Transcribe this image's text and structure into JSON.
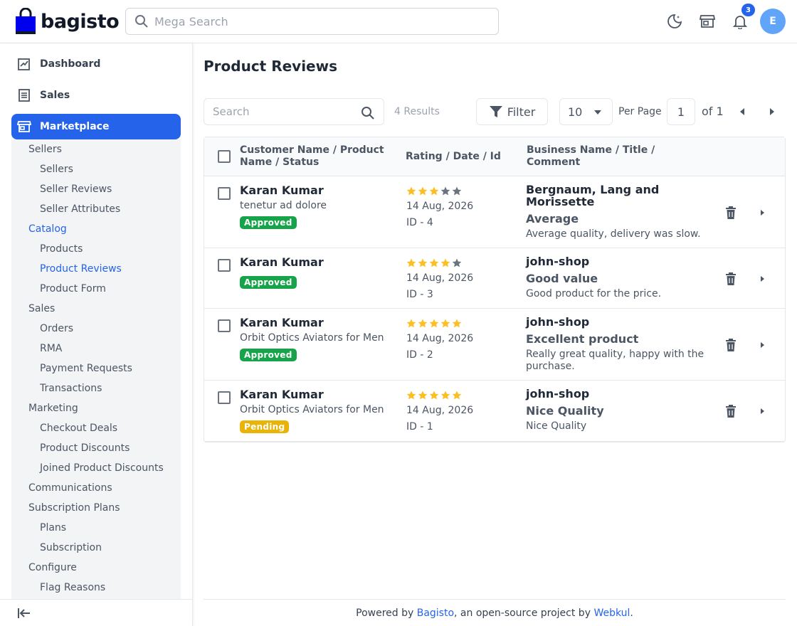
{
  "header": {
    "logo_text": "bagisto",
    "search_placeholder": "Mega Search",
    "notification_count": "3",
    "avatar_initial": "E"
  },
  "sidebar": {
    "top_items": [
      {
        "label": "Dashboard",
        "icon": "dashboard-icon"
      },
      {
        "label": "Sales",
        "icon": "sales-icon"
      },
      {
        "label": "Marketplace",
        "icon": "store-icon",
        "active": true
      }
    ],
    "submenu": [
      {
        "label": "Sellers",
        "level": 1
      },
      {
        "label": "Sellers",
        "level": 2
      },
      {
        "label": "Seller Reviews",
        "level": 2
      },
      {
        "label": "Seller Attributes",
        "level": 2
      },
      {
        "label": "Catalog",
        "level": 1,
        "highlighted": true
      },
      {
        "label": "Products",
        "level": 2
      },
      {
        "label": "Product Reviews",
        "level": 2,
        "highlighted": true
      },
      {
        "label": "Product Form",
        "level": 2
      },
      {
        "label": "Sales",
        "level": 1
      },
      {
        "label": "Orders",
        "level": 2
      },
      {
        "label": "RMA",
        "level": 2
      },
      {
        "label": "Payment Requests",
        "level": 2
      },
      {
        "label": "Transactions",
        "level": 2
      },
      {
        "label": "Marketing",
        "level": 1
      },
      {
        "label": "Checkout Deals",
        "level": 2
      },
      {
        "label": "Product Discounts",
        "level": 2
      },
      {
        "label": "Joined Product Discounts",
        "level": 2
      },
      {
        "label": "Communications",
        "level": 1
      },
      {
        "label": "Subscription Plans",
        "level": 1
      },
      {
        "label": "Plans",
        "level": 2
      },
      {
        "label": "Subscription",
        "level": 2
      },
      {
        "label": "Configure",
        "level": 1
      },
      {
        "label": "Flag Reasons",
        "level": 2
      }
    ]
  },
  "main": {
    "title": "Product Reviews",
    "search_placeholder": "Search",
    "results_label": "4 Results",
    "filter_label": "Filter",
    "per_page_value": "10",
    "per_page_label": "Per Page",
    "current_page": "1",
    "of_pages": "of 1"
  },
  "table": {
    "headers": {
      "customer": "Customer Name / Product Name / Status",
      "rating": "Rating / Date / Id",
      "business": "Business Name / Title / Comment"
    },
    "rows": [
      {
        "customer": "Karan Kumar",
        "product": "tenetur ad dolore",
        "status": "Approved",
        "rating": 3,
        "date": "14 Aug, 2026",
        "id": "ID - 4",
        "business": "Bergnaum, Lang and Morissette",
        "title": "Average",
        "comment": "Average quality, delivery was slow."
      },
      {
        "customer": "Karan Kumar",
        "product": "",
        "status": "Approved",
        "rating": 4,
        "date": "14 Aug, 2026",
        "id": "ID - 3",
        "business": "john-shop",
        "title": "Good value",
        "comment": "Good product for the price."
      },
      {
        "customer": "Karan Kumar",
        "product": "Orbit Optics Aviators for Men",
        "status": "Approved",
        "rating": 5,
        "date": "14 Aug, 2026",
        "id": "ID - 2",
        "business": "john-shop",
        "title": "Excellent product",
        "comment": "Really great quality, happy with the purchase."
      },
      {
        "customer": "Karan Kumar",
        "product": "Orbit Optics Aviators for Men",
        "status": "Pending",
        "rating": 5,
        "date": "14 Aug, 2026",
        "id": "ID - 1",
        "business": "john-shop",
        "title": "Nice Quality",
        "comment": "Nice Quality"
      }
    ]
  },
  "footer": {
    "prefix": "Powered by ",
    "link1": "Bagisto",
    "middle": ", an open-source project by ",
    "link2": "Webkul",
    "suffix": "."
  },
  "colors": {
    "accent": "#2563eb",
    "approved": "#16a34a",
    "pending": "#eab308",
    "star_on": "#fbbf24",
    "star_off": "#6b7280"
  }
}
